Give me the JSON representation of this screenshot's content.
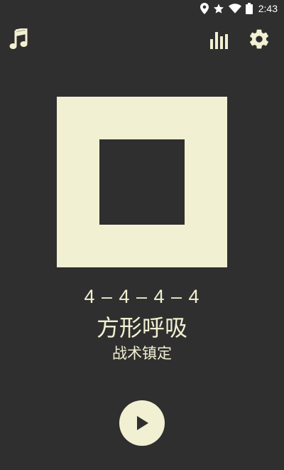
{
  "status_bar": {
    "time": "2:43",
    "icons": [
      "location-icon",
      "star-icon",
      "wifi-icon",
      "battery-icon"
    ]
  },
  "toolbar": {
    "left_icon": "music-note-icon",
    "right_icons": [
      "bar-chart-icon",
      "gear-icon"
    ]
  },
  "exercise": {
    "pattern": "4 – 4 – 4 – 4",
    "title": "方形呼吸",
    "subtitle": "战术镇定"
  },
  "controls": {
    "play_icon": "play-icon"
  },
  "colors": {
    "background": "#2f2f2f",
    "accent": "#f2f0d2",
    "play_triangle": "#2f2f2f"
  }
}
